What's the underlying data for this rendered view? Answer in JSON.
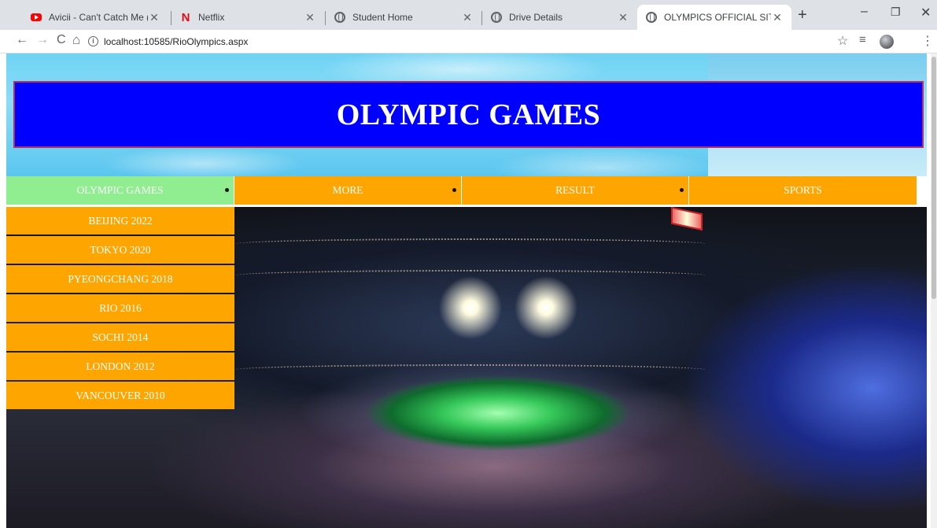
{
  "browser": {
    "tabs": [
      {
        "title": "Avicii - Can't Catch Me (Lyric V",
        "icon": "youtube-icon"
      },
      {
        "title": "Netflix",
        "icon": "netflix-icon"
      },
      {
        "title": "Student Home",
        "icon": "globe-icon"
      },
      {
        "title": "Drive Details",
        "icon": "globe-icon"
      },
      {
        "title": "OLYMPICS OFFICIAL SITE",
        "icon": "globe-icon",
        "active": true
      }
    ],
    "url": "localhost:10585/RioOlympics.aspx"
  },
  "page": {
    "banner_title": "OLYMPIC GAMES",
    "menu": [
      {
        "label": "OLYMPIC GAMES",
        "active": true,
        "has_submenu": true
      },
      {
        "label": "MORE",
        "has_submenu": true
      },
      {
        "label": "RESULT",
        "has_submenu": true
      },
      {
        "label": "SPORTS",
        "has_submenu": false
      }
    ],
    "submenu": [
      "BEIJING 2022",
      "TOKYO 2020",
      "PYEONGCHANG 2018",
      "RIO 2016",
      "SOCHI 2014",
      "LONDON 2012",
      "VANCOUVER 2010"
    ],
    "hero_image": "olympic-stadium-opening-ceremony",
    "colors": {
      "banner": "#0000ff",
      "banner_border": "#b03060",
      "menu": "#ffa500",
      "menu_active": "#90ee90"
    }
  }
}
